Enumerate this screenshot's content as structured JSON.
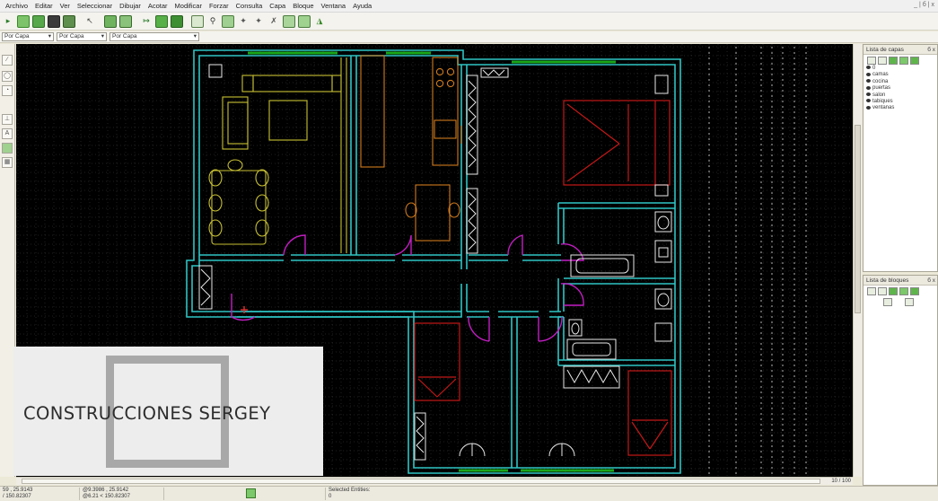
{
  "menubar": {
    "items": [
      "Archivo",
      "Editar",
      "Ver",
      "Seleccionar",
      "Dibujar",
      "Acotar",
      "Modificar",
      "Forzar",
      "Consulta",
      "Capa",
      "Bloque",
      "Ventana",
      "Ayuda"
    ],
    "window_controls": "_ | б | x"
  },
  "propbar": {
    "color": "Por Capa",
    "linetype": "Por Capa",
    "lineweight": "Por Capa"
  },
  "layers_panel": {
    "title": "Lista de capas",
    "controls": "б x",
    "layers": [
      "0",
      "camas",
      "cocina",
      "puertas",
      "salon",
      "tabiques",
      "ventanas"
    ]
  },
  "blocks_panel": {
    "title": "Lista de bloques",
    "controls": "б x"
  },
  "hscroll": {
    "page_counter": "10 / 100"
  },
  "status": {
    "abs_coords_1": "59 , 25.9143",
    "abs_coords_2": "/ 150.82307",
    "rel_coords_1": "@9.3986 , 25.9142",
    "rel_coords_2": "@6.21 < 150.82307",
    "selection_label": "Selected Entities:",
    "selection_count": "0"
  },
  "watermark": {
    "text": "CONSTRUCCIONES SERGEY"
  },
  "colors": {
    "walls": "#2fc4c4",
    "windows": "#1aa81a",
    "doors": "#c21ec2",
    "furniture_salon": "#c7c034",
    "furniture_cocina": "#d07a1e",
    "beds": "#c41818",
    "fixtures": "#e8e8e8",
    "grid": "#5a5a5a"
  }
}
